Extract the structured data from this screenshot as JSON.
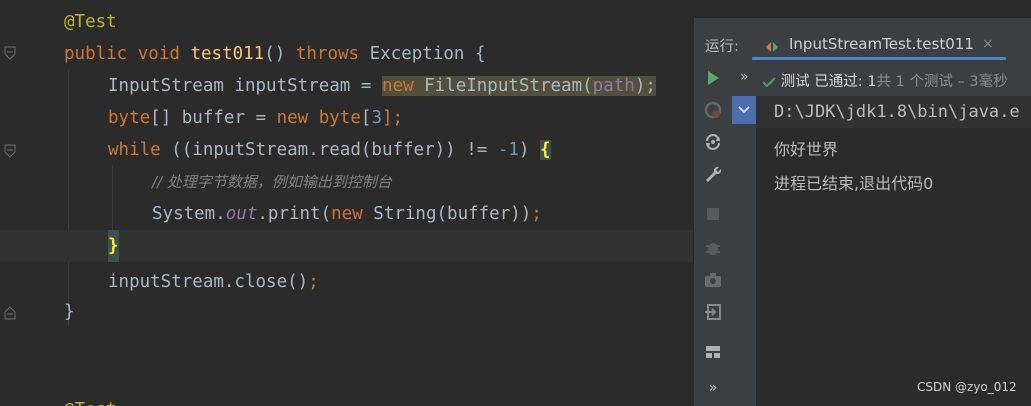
{
  "editor": {
    "annotation": "@Test",
    "kw_public": "public",
    "kw_void": "void",
    "method_name": "test011",
    "method_parens": "()",
    "kw_throws": "throws",
    "exception_type": "Exception {",
    "l3_type": "InputStream inputStream = ",
    "l3_new": "new",
    "l3_ctor": " FileInputStream(",
    "l3_param": "path",
    "l3_end": ");",
    "l4_byte": "byte",
    "l4_mid": "[] buffer = ",
    "l4_new": "new",
    "l4_byte2": " byte",
    "l4_open": "[",
    "l4_num": "3",
    "l4_end": "];",
    "l5_while": "while",
    "l5_mid": " ((inputStream.read(buffer)) != ",
    "l5_num": "-1",
    "l5_close": ") ",
    "l5_brace": "{",
    "l6_comment": "// 处理字节数据，例如输出到控制台",
    "l7_sys": "System.",
    "l7_out": "out",
    "l7_print": ".print(",
    "l7_new": "new",
    "l7_rest": " String(buffer))",
    "l7_semi": ";",
    "l8_brace": "}",
    "l9_close": "inputStream.close()",
    "l9_semi": ";",
    "l10_brace": "}",
    "l11_partial": "@Test"
  },
  "run_panel": {
    "label": "运行:",
    "tab_title": "InputStreamTest.test011",
    "tab_close": "×",
    "status_chevron": "»",
    "status_prefix": "测试",
    "status_passed": "已通过: 1",
    "status_rest": "共 1 个测试 – 3毫秒",
    "console_lines": {
      "path": "D:\\JDK\\jdk1.8\\bin\\java.e",
      "hello": "你好世界",
      "exit": "进程已结束,退出代码0"
    },
    "more_chevron": "»"
  },
  "watermark": "CSDN @zyo_012",
  "colors": {
    "editor_bg": "#2b2b2b",
    "keyword": "#cc7832",
    "function": "#ffc66d",
    "number": "#6897bb",
    "annotation": "#bbb529",
    "field": "#9876aa",
    "pass_green": "#499c54",
    "run_green": "#59a869",
    "tab_accent": "#4a88c7",
    "selection": "#4b6eaf"
  },
  "icons": [
    "fold-icon",
    "bulb-icon",
    "tab-run-icon",
    "run-icon",
    "rerun-failed-icon",
    "toggle-autotest-icon",
    "settings-wrench-icon",
    "stop-icon",
    "debug-icon",
    "screenshot-icon",
    "exit-icon",
    "layout-icon",
    "check-icon",
    "expand-icon"
  ]
}
